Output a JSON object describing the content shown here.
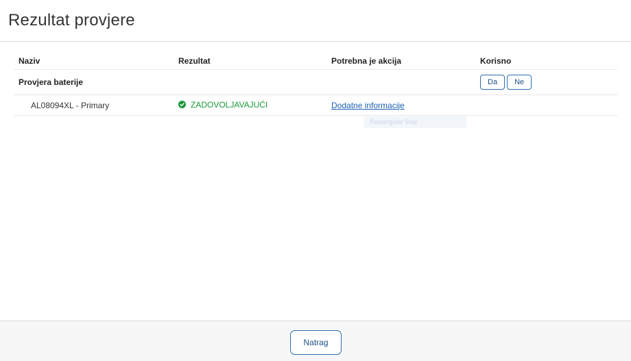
{
  "page": {
    "title": "Rezultat provjere"
  },
  "table": {
    "headers": {
      "name": "Naziv",
      "result": "Rezultat",
      "action": "Potrebna je akcija",
      "useful": "Korisno"
    },
    "group": {
      "label": "Provjera baterije",
      "yes_label": "Da",
      "no_label": "Ne"
    },
    "item": {
      "name": "AL08094XL - Primary",
      "result": "ZADOVOLJAVAJUĆI",
      "result_icon": "check-circle-icon",
      "result_color": "#1a9a3a",
      "action_link": "Dodatne informacije"
    }
  },
  "overlay": {
    "snip_label": "Rectangular Snip"
  },
  "footer": {
    "back_label": "Natrag"
  },
  "colors": {
    "accent": "#2b6cb0",
    "link": "#1a5fb4",
    "success": "#1a9a3a"
  }
}
